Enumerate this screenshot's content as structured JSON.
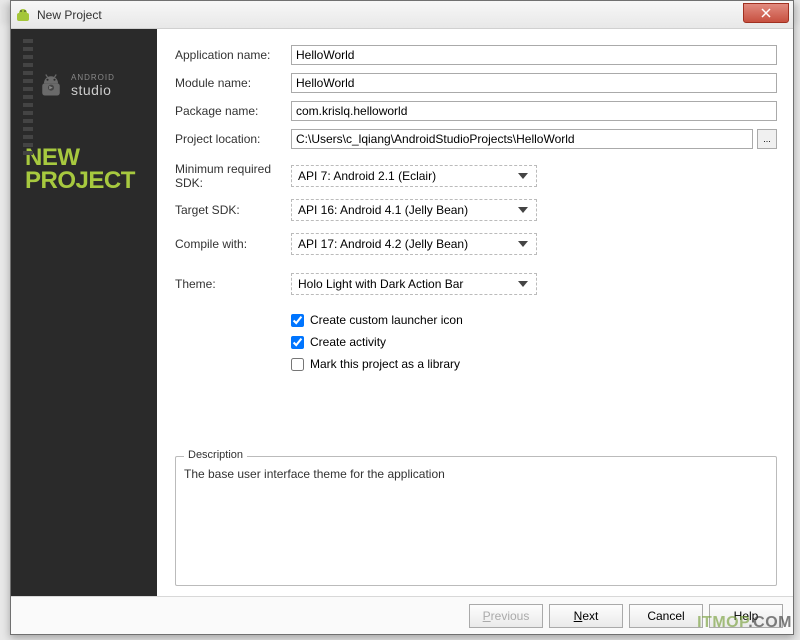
{
  "window": {
    "title": "New Project"
  },
  "sidebar": {
    "brand_small": "ANDROID",
    "brand_big": "studio",
    "heading_line1": "NEW",
    "heading_line2": "PROJECT"
  },
  "form": {
    "app_name_label": "Application name:",
    "app_name_value": "HelloWorld",
    "module_name_label": "Module name:",
    "module_name_value": "HelloWorld",
    "package_name_label": "Package name:",
    "package_name_value": "com.krislq.helloworld",
    "project_location_label": "Project location:",
    "project_location_value": "C:\\Users\\c_lqiang\\AndroidStudioProjects\\HelloWorld",
    "browse_label": "...",
    "min_sdk_label": "Minimum required SDK:",
    "min_sdk_value": "API 7: Android 2.1 (Eclair)",
    "target_sdk_label": "Target SDK:",
    "target_sdk_value": "API 16: Android 4.1 (Jelly Bean)",
    "compile_with_label": "Compile with:",
    "compile_with_value": "API 17: Android 4.2 (Jelly Bean)",
    "theme_label": "Theme:",
    "theme_value": "Holo Light with Dark Action Bar",
    "check1_label": "Create custom launcher icon",
    "check1_checked": true,
    "check2_label": "Create activity",
    "check2_checked": true,
    "check3_label": "Mark this project as a library",
    "check3_checked": false
  },
  "description": {
    "legend": "Description",
    "text": "The base user interface theme for the application"
  },
  "footer": {
    "previous": "Previous",
    "next": "Next",
    "cancel": "Cancel",
    "help": "Help"
  },
  "watermark": {
    "text1": "ITMOP",
    "text2": ".COM"
  }
}
